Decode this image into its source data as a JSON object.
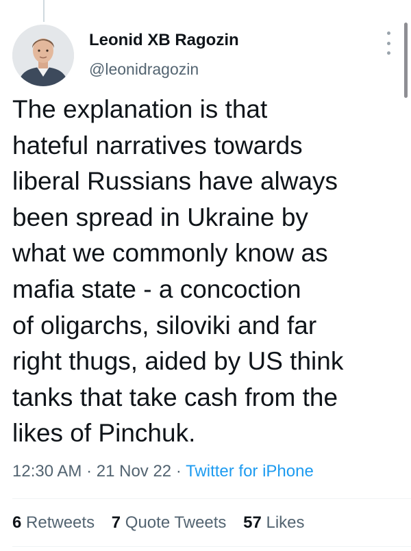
{
  "tweet": {
    "author_name": "Leonid XB Ragozin",
    "author_handle": "@leonidragozin",
    "text_lines": [
      "The explanation is that",
      "hateful narratives towards",
      "liberal Russians have always",
      "been spread in Ukraine by",
      "what we commonly know as",
      "mafia state - a concoction",
      "of oligarchs, siloviki and far",
      "right thugs, aided by US think",
      "tanks that take cash from the",
      "likes of Pinchuk."
    ],
    "time": "12:30 AM",
    "separator": "·",
    "date": "21 Nov 22",
    "source": "Twitter for iPhone"
  },
  "stats": {
    "retweets_count": "6",
    "retweets_label": "Retweets",
    "quotes_count": "7",
    "quotes_label": "Quote Tweets",
    "likes_count": "57",
    "likes_label": "Likes"
  },
  "icons": {
    "more": "more-vertical-icon"
  },
  "colors": {
    "text": "#0f1419",
    "secondary": "#536471",
    "link": "#1d9bf0",
    "divider": "#eff3f4"
  }
}
